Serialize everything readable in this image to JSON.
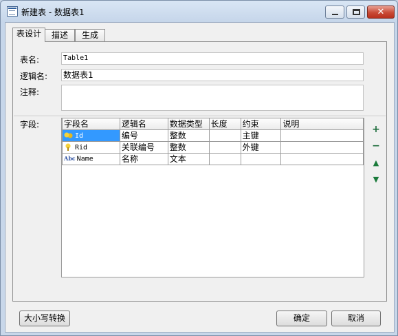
{
  "window": {
    "title": "新建表 - 数据表1"
  },
  "tabs": [
    {
      "label": "表设计"
    },
    {
      "label": "描述"
    },
    {
      "label": "生成"
    }
  ],
  "form": {
    "table_name_label": "表名:",
    "table_name_value": "Table1",
    "logic_name_label": "逻辑名:",
    "logic_name_value": "数据表1",
    "comment_label": "注释:",
    "comment_value": "",
    "fields_label": "字段:"
  },
  "grid": {
    "columns": [
      "字段名",
      "逻辑名",
      "数据类型",
      "长度",
      "约束",
      "说明"
    ],
    "rows": [
      {
        "icon": "primary-key-icon",
        "name": "Id",
        "logic": "编号",
        "type": "整数",
        "length": "",
        "constraint": "主键",
        "desc": ""
      },
      {
        "icon": "foreign-key-icon",
        "name": "Rid",
        "logic": "关联编号",
        "type": "整数",
        "length": "",
        "constraint": "外键",
        "desc": ""
      },
      {
        "icon": "text-field-icon",
        "icon_text": "Abc",
        "name": "Name",
        "logic": "名称",
        "type": "文本",
        "length": "",
        "constraint": "",
        "desc": ""
      }
    ]
  },
  "side_buttons": {
    "add": "+",
    "remove": "−",
    "up": "▲",
    "down": "▼"
  },
  "buttons": {
    "case_convert": "大小写转换",
    "ok": "确定",
    "cancel": "取消"
  }
}
